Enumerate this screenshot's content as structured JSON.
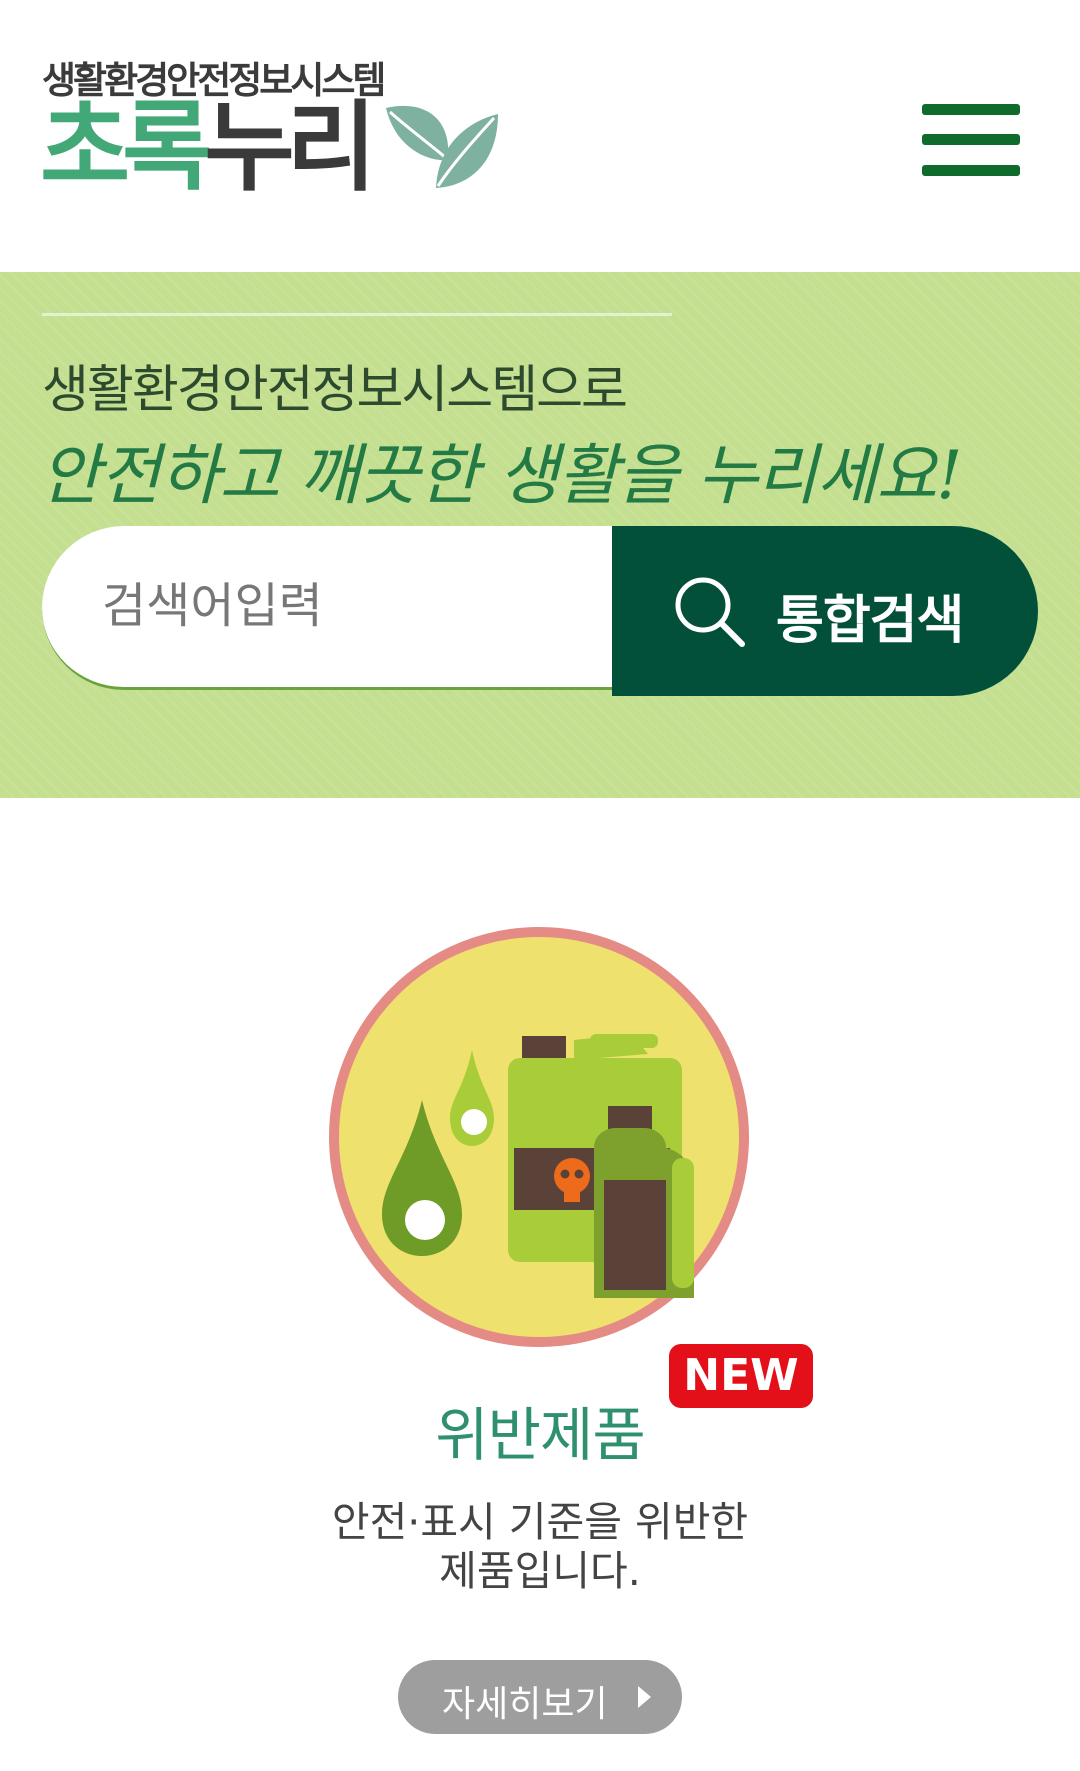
{
  "header": {
    "logo_subtitle": "생활환경안전정보시스템",
    "logo_title_green": "초록",
    "logo_title_dark": "누리",
    "menu_icon": "hamburger-menu-icon"
  },
  "hero": {
    "subtitle": "생활환경안전정보시스템으로",
    "slogan": "안전하고 깨끗한 생활을 누리세요!",
    "search": {
      "placeholder": "검색어입력",
      "button_label": "통합검색",
      "button_icon": "search-icon"
    }
  },
  "card": {
    "icon": "toxic-chemicals-icon",
    "badge": "NEW",
    "title": "위반제품",
    "description_line1": "안전·표시 기준을 위반한",
    "description_line2": "제품입니다.",
    "button_label": "자세히보기",
    "button_icon": "chevron-right-icon"
  },
  "colors": {
    "brand_green": "#43a878",
    "hero_bg": "#c3df8f",
    "search_button": "#02503a",
    "menu_icon": "#0f6b2c",
    "badge_red": "#e3101a",
    "card_title": "#2f9070",
    "detail_button": "#9e9e9e"
  }
}
